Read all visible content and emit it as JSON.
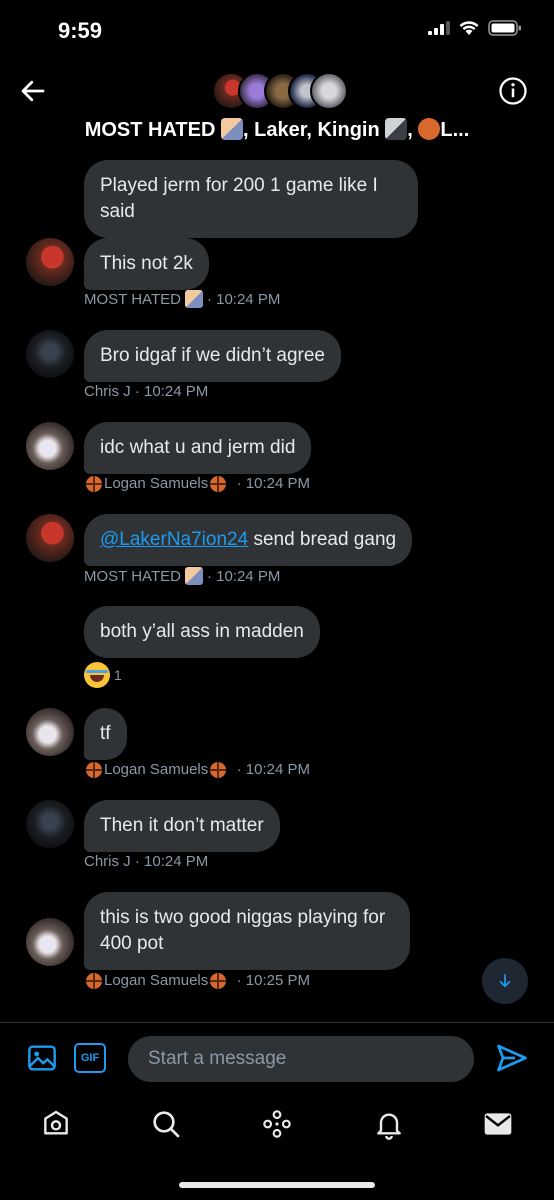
{
  "status_bar": {
    "time": "9:59"
  },
  "header": {
    "title": "MOST HATED",
    "title_rest": ", Laker, Kingin",
    "title_sep": ",",
    "title_end": "L..."
  },
  "messages": [
    {
      "text": "Played jerm for 200 1 game like I said"
    },
    {
      "text": "This not 2k",
      "sender": "MOST HATED",
      "time": "· 10:24 PM"
    },
    {
      "text": "Bro idgaf if we didn’t agree",
      "sender": "Chris J",
      "time": "· 10:24 PM"
    },
    {
      "text": "idc what u and jerm did",
      "sender": "Logan Samuels",
      "time": "· 10:24 PM"
    },
    {
      "mention": "@LakerNa7ion24",
      "text": " send bread gang",
      "sender": "MOST HATED",
      "time": "· 10:24 PM"
    },
    {
      "text": "both y’all ass in madden",
      "reaction_count": "1"
    },
    {
      "text": "tf",
      "sender": "Logan Samuels",
      "time": "· 10:24 PM"
    },
    {
      "text": "Then it don’t matter",
      "sender": "Chris J",
      "time": "· 10:24 PM"
    },
    {
      "text": "this is two good niggas playing for 400 pot",
      "sender": "Logan Samuels",
      "time": "· 10:25 PM"
    }
  ],
  "composer": {
    "placeholder": "Start a message",
    "gif_label": "GIF"
  },
  "icons": {
    "back": "back-arrow-icon",
    "info": "info-icon",
    "image": "image-icon",
    "gif": "gif-icon",
    "send": "send-icon",
    "scroll_down": "arrow-down-icon",
    "home": "home-icon",
    "search": "search-icon",
    "spaces": "communities-icon",
    "notifications": "bell-icon",
    "messages": "mail-icon"
  },
  "colors": {
    "background": "#000000",
    "bubble": "#2f3336",
    "accent": "#1d9bf0",
    "meta": "#8b98a5"
  }
}
